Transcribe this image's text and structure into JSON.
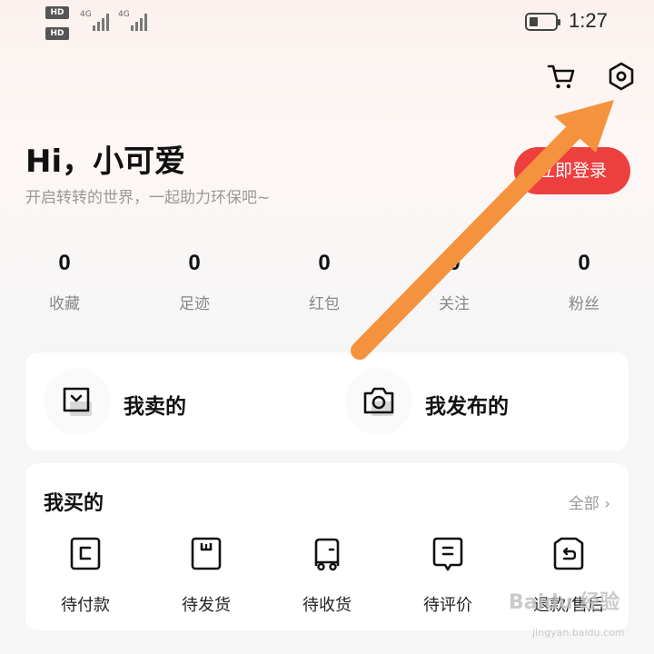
{
  "status_bar": {
    "sim1_badge": "HD",
    "sim2_badge": "HD",
    "network_1": "4G",
    "network_2": "4G",
    "time": "1:27"
  },
  "header": {
    "icons": [
      "cart-icon",
      "settings-icon"
    ]
  },
  "profile": {
    "greeting": "Hi，小可爱",
    "subtitle": "开启转转的世界，一起助力环保吧~",
    "login_label": "立即登录"
  },
  "stats": [
    {
      "value": "0",
      "label": "收藏"
    },
    {
      "value": "0",
      "label": "足迹"
    },
    {
      "value": "0",
      "label": "红包"
    },
    {
      "value": "0",
      "label": "关注"
    },
    {
      "value": "0",
      "label": "粉丝"
    }
  ],
  "sell_card": {
    "sold_label": "我卖的",
    "published_label": "我发布的"
  },
  "buy_card": {
    "title": "我买的",
    "all_label": "全部 ›",
    "items": [
      {
        "label": "待付款",
        "icon": "wallet-icon"
      },
      {
        "label": "待发货",
        "icon": "box-icon"
      },
      {
        "label": "待收货",
        "icon": "truck-icon"
      },
      {
        "label": "待评价",
        "icon": "comment-icon"
      },
      {
        "label": "退款/售后",
        "icon": "refund-icon"
      }
    ]
  },
  "watermark": {
    "text": "Baidu 经验",
    "url": "jingyan.baidu.com"
  },
  "colors": {
    "accent": "#ee3f3f",
    "arrow": "#f5923e"
  }
}
